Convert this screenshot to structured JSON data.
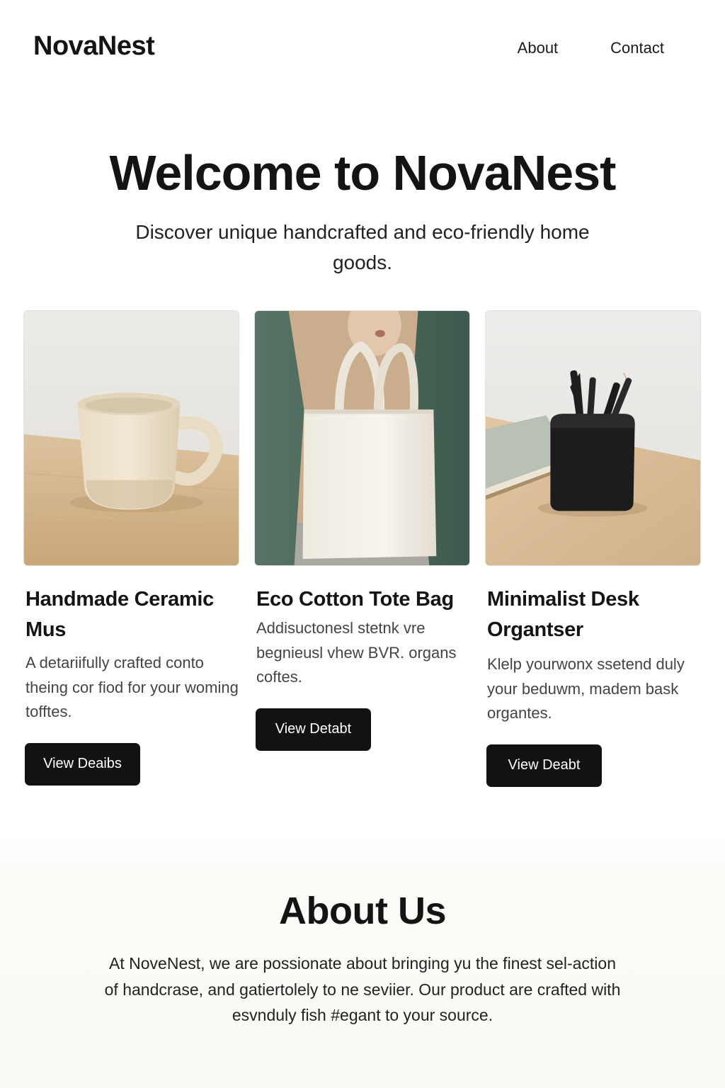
{
  "header": {
    "logo": "NovaNest",
    "nav": [
      "About",
      "Contact"
    ]
  },
  "hero": {
    "title": "Welcome to NovaNest",
    "subtitle": "Discover unique  handcrafted  and eco-friendly home goods."
  },
  "products": [
    {
      "name": "Handmade Ceramic Mus",
      "description": "A detariifully crafted conto theing cor fiod for your woming tofftes.",
      "button_label": "View Deaibs",
      "image_icon": "ceramic-mug"
    },
    {
      "name": "Eco Cotton Tote Bag",
      "description": "Addisuctonesl stetnk vre begnieusl vhew BVR. organs coftes.",
      "button_label": "View Detabt",
      "image_icon": "tote-bag"
    },
    {
      "name": "Minimalist Desk Organtser",
      "description": "Klelp yourwonx ssetend duly your beduwm, madem bask organtes.",
      "button_label": "View Deabt",
      "image_icon": "pen-holder"
    }
  ],
  "about": {
    "title": "About Us",
    "text": "At NoveNest, we are possionate about bringing yu the finest sel-action of handcrase, and gatiertolely to ne seviier. Our product are crafted with esvnduly fish #egant to your source."
  },
  "colors": {
    "text": "#141414",
    "button_bg": "#121212",
    "button_text": "#ffffff",
    "tote_background": "#4f6a5d",
    "wood": "#d6bb94"
  }
}
